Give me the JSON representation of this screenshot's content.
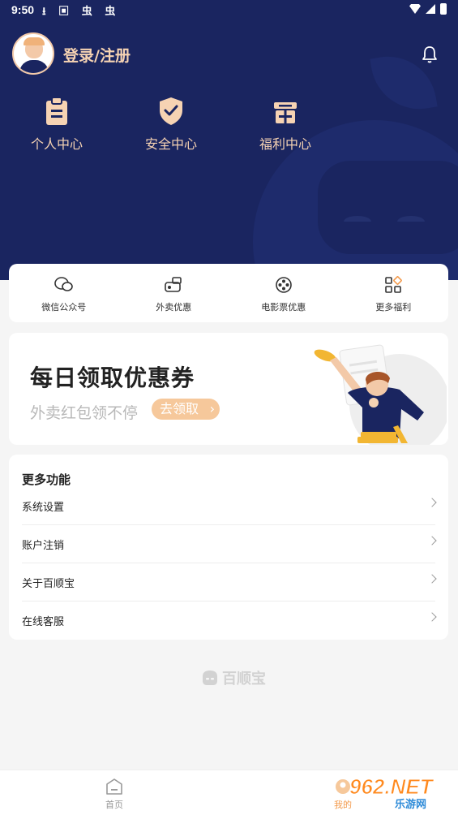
{
  "status_bar": {
    "time": "9:50",
    "icons": [
      "download-icon",
      "a-icon",
      "bug-icon",
      "bug-icon",
      "wifi-icon",
      "signal-icon",
      "battery-icon"
    ]
  },
  "header": {
    "login_label": "登录/注册",
    "quick_links": [
      {
        "label": "个人中心",
        "icon": "clipboard-icon"
      },
      {
        "label": "安全中心",
        "icon": "shield-check-icon"
      },
      {
        "label": "福利中心",
        "icon": "gift-icon"
      }
    ]
  },
  "services": [
    {
      "label": "微信公众号",
      "icon": "wechat-icon"
    },
    {
      "label": "外卖优惠",
      "icon": "takeout-icon"
    },
    {
      "label": "电影票优惠",
      "icon": "film-reel-icon"
    },
    {
      "label": "更多福利",
      "icon": "grid-icon"
    }
  ],
  "banner": {
    "title": "每日领取优惠券",
    "subtitle": "外卖红包领不停",
    "button": "去领取"
  },
  "menu": {
    "title": "更多功能",
    "items": [
      "系统设置",
      "账户注销",
      "关于百顺宝",
      "在线客服"
    ]
  },
  "brand": "百顺宝",
  "tabbar": {
    "tabs": [
      {
        "label": "首页",
        "icon": "home-icon"
      },
      {
        "label": "我的",
        "icon": "profile-icon"
      }
    ]
  },
  "watermark": {
    "main": "962.NET",
    "sub": "乐游网"
  },
  "colors": {
    "header_bg": "#1a2560",
    "accent_gold": "#f6d3b3",
    "button_orange": "#f6c89b"
  }
}
